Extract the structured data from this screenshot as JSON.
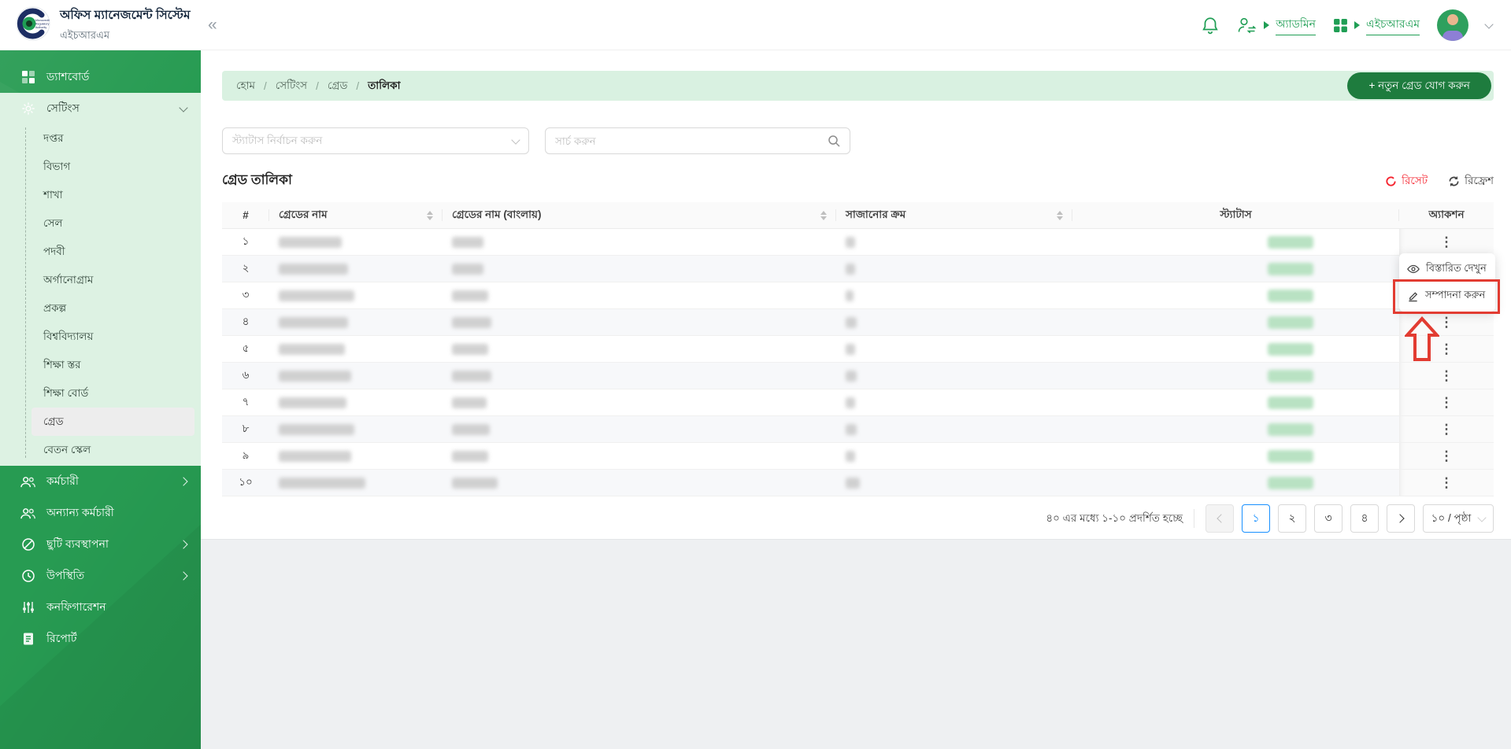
{
  "colors": {
    "sidebar_green": "#279b52",
    "submenu_bg": "#ddf2e3",
    "breadcrumb_bg": "#d9f1e1",
    "primary_button_green": "#1e7c3e",
    "link_green": "#1f9e54",
    "reset_red": "#f5222d",
    "annotation_red": "#e23c32",
    "pagination_active_blue": "#1890ff",
    "status_badge_green": "#b9e2c3"
  },
  "header": {
    "app_title": "অফিস ম্যানেজমেন্ট সিস্টেম",
    "app_subtitle": "এইচআরএম",
    "logo_caption_lines": [
      "Microcredit",
      "Regulatory",
      "Authority"
    ],
    "collapse_glyph": "«",
    "admin_label": "অ্যাডমিন",
    "app_switch_label": "এইচআরএম"
  },
  "sidebar": {
    "items": [
      {
        "id": "dashboard",
        "icon": "dashboard-icon",
        "label": "ড্যাশবোর্ড"
      },
      {
        "id": "settings",
        "icon": "gear-icon",
        "label": "সেটিংস",
        "expanded": true,
        "active_child": "গ্রেড",
        "children": [
          {
            "id": "office",
            "label": "দপ্তর"
          },
          {
            "id": "division",
            "label": "বিভাগ"
          },
          {
            "id": "branch",
            "label": "শাখা"
          },
          {
            "id": "cell",
            "label": "সেল"
          },
          {
            "id": "designation",
            "label": "পদবী"
          },
          {
            "id": "organogram",
            "label": "অর্গানোগ্রাম"
          },
          {
            "id": "project",
            "label": "প্রকল্প"
          },
          {
            "id": "university",
            "label": "বিশ্ববিদ্যালয়"
          },
          {
            "id": "education-level",
            "label": "শিক্ষা স্তর"
          },
          {
            "id": "education-board",
            "label": "শিক্ষা বোর্ড"
          },
          {
            "id": "grade",
            "label": "গ্রেড"
          },
          {
            "id": "pay-scale",
            "label": "বেতন স্কেল"
          }
        ]
      },
      {
        "id": "employees",
        "icon": "employees-icon",
        "label": "কর্মচারী",
        "chevron": true
      },
      {
        "id": "other-employees",
        "icon": "other-employees-icon",
        "label": "অন্যান্য কর্মচারী"
      },
      {
        "id": "leave-management",
        "icon": "leave-icon",
        "label": "ছুটি ব্যবস্থাপনা",
        "chevron": true
      },
      {
        "id": "attendance",
        "icon": "attendance-icon",
        "label": "উপস্থিতি",
        "chevron": true
      },
      {
        "id": "configuration",
        "icon": "configuration-icon",
        "label": "কনফিগারেশন"
      },
      {
        "id": "report",
        "icon": "report-icon",
        "label": "রিপোর্ট"
      }
    ]
  },
  "breadcrumb": [
    "হোম",
    "সেটিংস",
    "গ্রেড",
    "তালিকা"
  ],
  "add_button_label": "+ নতুন গ্রেড যোগ করুন",
  "filters": {
    "status_placeholder": "স্ট্যাটাস নির্বাচন করুন",
    "search_placeholder": "সার্চ করুন"
  },
  "table": {
    "title": "গ্রেড তালিকা",
    "reset_label": "রিসেট",
    "refresh_label": "রিফ্রেশ",
    "columns": [
      "#",
      "গ্রেডের নাম",
      "গ্রেডের নাম (বাংলায়)",
      "সাজানোর ক্রম",
      "স্ট্যাটাস",
      "অ্যাকশন"
    ],
    "sortable_columns": [
      1,
      2,
      3
    ],
    "rows": [
      {
        "serial": "১",
        "name_w": 80,
        "bn_w": 40,
        "order_w": 12
      },
      {
        "serial": "২",
        "name_w": 88,
        "bn_w": 40,
        "order_w": 12
      },
      {
        "serial": "৩",
        "name_w": 96,
        "bn_w": 46,
        "order_w": 10
      },
      {
        "serial": "৪",
        "name_w": 88,
        "bn_w": 50,
        "order_w": 14
      },
      {
        "serial": "৫",
        "name_w": 84,
        "bn_w": 46,
        "order_w": 12
      },
      {
        "serial": "৬",
        "name_w": 92,
        "bn_w": 50,
        "order_w": 14
      },
      {
        "serial": "৭",
        "name_w": 86,
        "bn_w": 44,
        "order_w": 12
      },
      {
        "serial": "৮",
        "name_w": 96,
        "bn_w": 48,
        "order_w": 14
      },
      {
        "serial": "৯",
        "name_w": 92,
        "bn_w": 46,
        "order_w": 12
      },
      {
        "serial": "১০",
        "name_w": 110,
        "bn_w": 58,
        "order_w": 18
      }
    ]
  },
  "action_menu": {
    "items": [
      {
        "label": "বিস্তারিত দেখুন",
        "icon": "eye-icon"
      },
      {
        "label": "সম্পাদনা করুন",
        "icon": "edit-icon",
        "highlighted": true
      }
    ]
  },
  "pagination": {
    "summary": "৪০ এর মধ্যে ১-১০ প্রদর্শিত হচ্ছে",
    "pages": [
      "১",
      "২",
      "৩",
      "৪"
    ],
    "active_page": "১",
    "page_size": "১০ / পৃষ্ঠা"
  }
}
